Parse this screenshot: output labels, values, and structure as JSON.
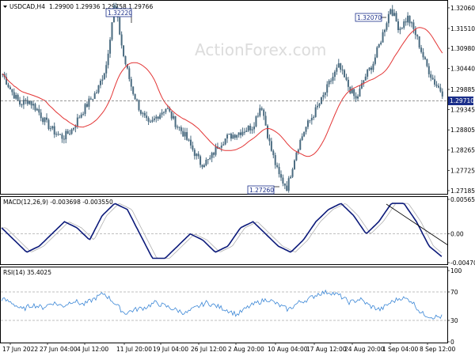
{
  "symbol_line": {
    "symbol": "USDCAD,H4",
    "values": "1.29900 1.29936 1.29758 1.29766"
  },
  "watermark": "ActionForex.com",
  "colors": {
    "candle": "#4a6b80",
    "ma": "#e33535",
    "macd": "#0c1a7a",
    "signal": "#b0b0b0",
    "rsi": "#3a86d6",
    "price_label_bg": "#1b2f8a",
    "trendline": "#000000"
  },
  "price_labels": {
    "current": "1.29710",
    "annotations": [
      {
        "text": "1.32220"
      },
      {
        "text": "1.32070"
      },
      {
        "text": "1.27260"
      }
    ]
  },
  "macd_header": "MACD(12,26,9) -0.003698 -0.003550",
  "rsi_header": "RSI(14) 35.4025",
  "chart_data": [
    {
      "type": "line",
      "title": "USDCAD,H4",
      "series": [
        {
          "name": "USDCAD",
          "values_sampled": [
            1.303,
            1.2985,
            1.295,
            1.296,
            1.2935,
            1.29,
            1.2875,
            1.286,
            1.288,
            1.292,
            1.2955,
            1.2985,
            1.305,
            1.3222,
            1.308,
            1.299,
            1.293,
            1.289,
            1.292,
            1.294,
            1.29,
            1.287,
            1.283,
            1.279,
            1.28,
            1.284,
            1.286,
            1.287,
            1.288,
            1.289,
            1.295,
            1.284,
            1.276,
            1.2726,
            1.282,
            1.288,
            1.292,
            1.296,
            1.301,
            1.305,
            1.3,
            1.296,
            1.302,
            1.306,
            1.313,
            1.3207,
            1.315,
            1.318,
            1.313,
            1.306,
            1.301,
            1.298
          ]
        }
      ],
      "ylim": [
        1.2712,
        1.32206
      ],
      "y_ticks": [
        "1.32060",
        "1.31510",
        "1.30980",
        "1.30440",
        "1.29885",
        "1.29345",
        "1.28805",
        "1.28265",
        "1.27725",
        "1.27185"
      ],
      "x_tick_labels": [
        "17 Jun 2022",
        "27 Jun 04:00",
        "4 Jul 12:00",
        "11 Jul 20:00",
        "19 Jul 04:00",
        "26 Jul 12:00",
        "2 Aug 20:00",
        "10 Aug 04:00",
        "17 Aug 12:00",
        "24 Aug 20:00",
        "1 Sep 04:00",
        "8 Sep 12:00"
      ]
    },
    {
      "type": "line",
      "title": "MACD(12,26,9)",
      "series": [
        {
          "name": "MACD",
          "values_sampled": [
            0.001,
            -0.001,
            -0.003,
            -0.002,
            0.0,
            0.002,
            0.001,
            -0.001,
            0.003,
            0.005,
            0.004,
            0.0,
            -0.004,
            -0.004,
            -0.002,
            0.0,
            -0.001,
            -0.003,
            -0.002,
            0.001,
            0.002,
            0.0,
            -0.002,
            -0.003,
            -0.001,
            0.002,
            0.004,
            0.005,
            0.003,
            0.0,
            0.002,
            0.005,
            0.005,
            0.002,
            -0.002,
            -0.0037
          ]
        }
      ],
      "y_ticks": [
        "0.005657",
        "0.00",
        "-0.004707"
      ]
    },
    {
      "type": "line",
      "title": "RSI(14)",
      "series": [
        {
          "name": "RSI",
          "values_sampled": [
            60,
            55,
            45,
            52,
            48,
            55,
            50,
            58,
            52,
            60,
            68,
            55,
            40,
            45,
            48,
            55,
            50,
            45,
            40,
            48,
            55,
            50,
            45,
            38,
            48,
            55,
            60,
            52,
            45,
            55,
            60,
            68,
            70,
            65,
            55,
            60,
            50,
            45,
            55,
            62,
            58,
            40,
            35,
            35
          ]
        }
      ],
      "ylim": [
        0,
        100
      ],
      "y_ticks": [
        "100",
        "70",
        "30",
        "0"
      ]
    }
  ]
}
